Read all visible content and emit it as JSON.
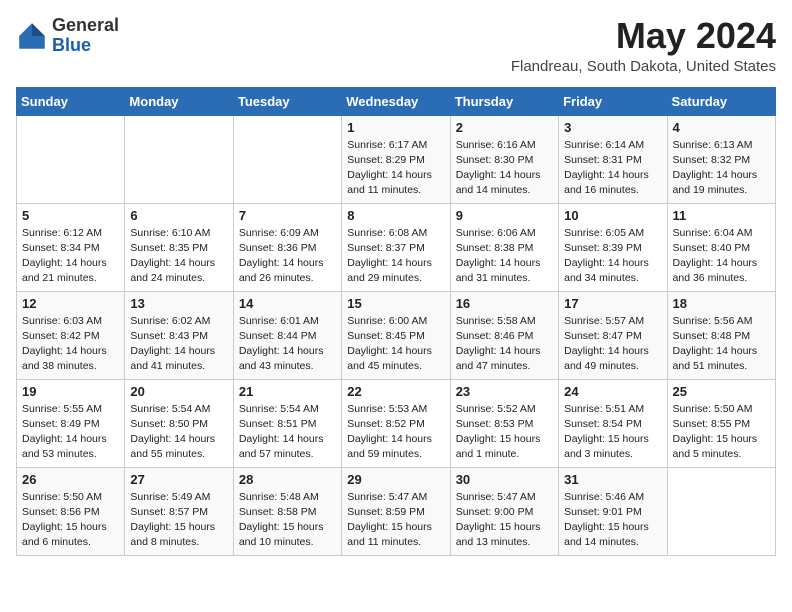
{
  "header": {
    "logo_general": "General",
    "logo_blue": "Blue",
    "month": "May 2024",
    "location": "Flandreau, South Dakota, United States"
  },
  "weekdays": [
    "Sunday",
    "Monday",
    "Tuesday",
    "Wednesday",
    "Thursday",
    "Friday",
    "Saturday"
  ],
  "weeks": [
    [
      {
        "day": "",
        "text": ""
      },
      {
        "day": "",
        "text": ""
      },
      {
        "day": "",
        "text": ""
      },
      {
        "day": "1",
        "text": "Sunrise: 6:17 AM\nSunset: 8:29 PM\nDaylight: 14 hours\nand 11 minutes."
      },
      {
        "day": "2",
        "text": "Sunrise: 6:16 AM\nSunset: 8:30 PM\nDaylight: 14 hours\nand 14 minutes."
      },
      {
        "day": "3",
        "text": "Sunrise: 6:14 AM\nSunset: 8:31 PM\nDaylight: 14 hours\nand 16 minutes."
      },
      {
        "day": "4",
        "text": "Sunrise: 6:13 AM\nSunset: 8:32 PM\nDaylight: 14 hours\nand 19 minutes."
      }
    ],
    [
      {
        "day": "5",
        "text": "Sunrise: 6:12 AM\nSunset: 8:34 PM\nDaylight: 14 hours\nand 21 minutes."
      },
      {
        "day": "6",
        "text": "Sunrise: 6:10 AM\nSunset: 8:35 PM\nDaylight: 14 hours\nand 24 minutes."
      },
      {
        "day": "7",
        "text": "Sunrise: 6:09 AM\nSunset: 8:36 PM\nDaylight: 14 hours\nand 26 minutes."
      },
      {
        "day": "8",
        "text": "Sunrise: 6:08 AM\nSunset: 8:37 PM\nDaylight: 14 hours\nand 29 minutes."
      },
      {
        "day": "9",
        "text": "Sunrise: 6:06 AM\nSunset: 8:38 PM\nDaylight: 14 hours\nand 31 minutes."
      },
      {
        "day": "10",
        "text": "Sunrise: 6:05 AM\nSunset: 8:39 PM\nDaylight: 14 hours\nand 34 minutes."
      },
      {
        "day": "11",
        "text": "Sunrise: 6:04 AM\nSunset: 8:40 PM\nDaylight: 14 hours\nand 36 minutes."
      }
    ],
    [
      {
        "day": "12",
        "text": "Sunrise: 6:03 AM\nSunset: 8:42 PM\nDaylight: 14 hours\nand 38 minutes."
      },
      {
        "day": "13",
        "text": "Sunrise: 6:02 AM\nSunset: 8:43 PM\nDaylight: 14 hours\nand 41 minutes."
      },
      {
        "day": "14",
        "text": "Sunrise: 6:01 AM\nSunset: 8:44 PM\nDaylight: 14 hours\nand 43 minutes."
      },
      {
        "day": "15",
        "text": "Sunrise: 6:00 AM\nSunset: 8:45 PM\nDaylight: 14 hours\nand 45 minutes."
      },
      {
        "day": "16",
        "text": "Sunrise: 5:58 AM\nSunset: 8:46 PM\nDaylight: 14 hours\nand 47 minutes."
      },
      {
        "day": "17",
        "text": "Sunrise: 5:57 AM\nSunset: 8:47 PM\nDaylight: 14 hours\nand 49 minutes."
      },
      {
        "day": "18",
        "text": "Sunrise: 5:56 AM\nSunset: 8:48 PM\nDaylight: 14 hours\nand 51 minutes."
      }
    ],
    [
      {
        "day": "19",
        "text": "Sunrise: 5:55 AM\nSunset: 8:49 PM\nDaylight: 14 hours\nand 53 minutes."
      },
      {
        "day": "20",
        "text": "Sunrise: 5:54 AM\nSunset: 8:50 PM\nDaylight: 14 hours\nand 55 minutes."
      },
      {
        "day": "21",
        "text": "Sunrise: 5:54 AM\nSunset: 8:51 PM\nDaylight: 14 hours\nand 57 minutes."
      },
      {
        "day": "22",
        "text": "Sunrise: 5:53 AM\nSunset: 8:52 PM\nDaylight: 14 hours\nand 59 minutes."
      },
      {
        "day": "23",
        "text": "Sunrise: 5:52 AM\nSunset: 8:53 PM\nDaylight: 15 hours\nand 1 minute."
      },
      {
        "day": "24",
        "text": "Sunrise: 5:51 AM\nSunset: 8:54 PM\nDaylight: 15 hours\nand 3 minutes."
      },
      {
        "day": "25",
        "text": "Sunrise: 5:50 AM\nSunset: 8:55 PM\nDaylight: 15 hours\nand 5 minutes."
      }
    ],
    [
      {
        "day": "26",
        "text": "Sunrise: 5:50 AM\nSunset: 8:56 PM\nDaylight: 15 hours\nand 6 minutes."
      },
      {
        "day": "27",
        "text": "Sunrise: 5:49 AM\nSunset: 8:57 PM\nDaylight: 15 hours\nand 8 minutes."
      },
      {
        "day": "28",
        "text": "Sunrise: 5:48 AM\nSunset: 8:58 PM\nDaylight: 15 hours\nand 10 minutes."
      },
      {
        "day": "29",
        "text": "Sunrise: 5:47 AM\nSunset: 8:59 PM\nDaylight: 15 hours\nand 11 minutes."
      },
      {
        "day": "30",
        "text": "Sunrise: 5:47 AM\nSunset: 9:00 PM\nDaylight: 15 hours\nand 13 minutes."
      },
      {
        "day": "31",
        "text": "Sunrise: 5:46 AM\nSunset: 9:01 PM\nDaylight: 15 hours\nand 14 minutes."
      },
      {
        "day": "",
        "text": ""
      }
    ]
  ]
}
